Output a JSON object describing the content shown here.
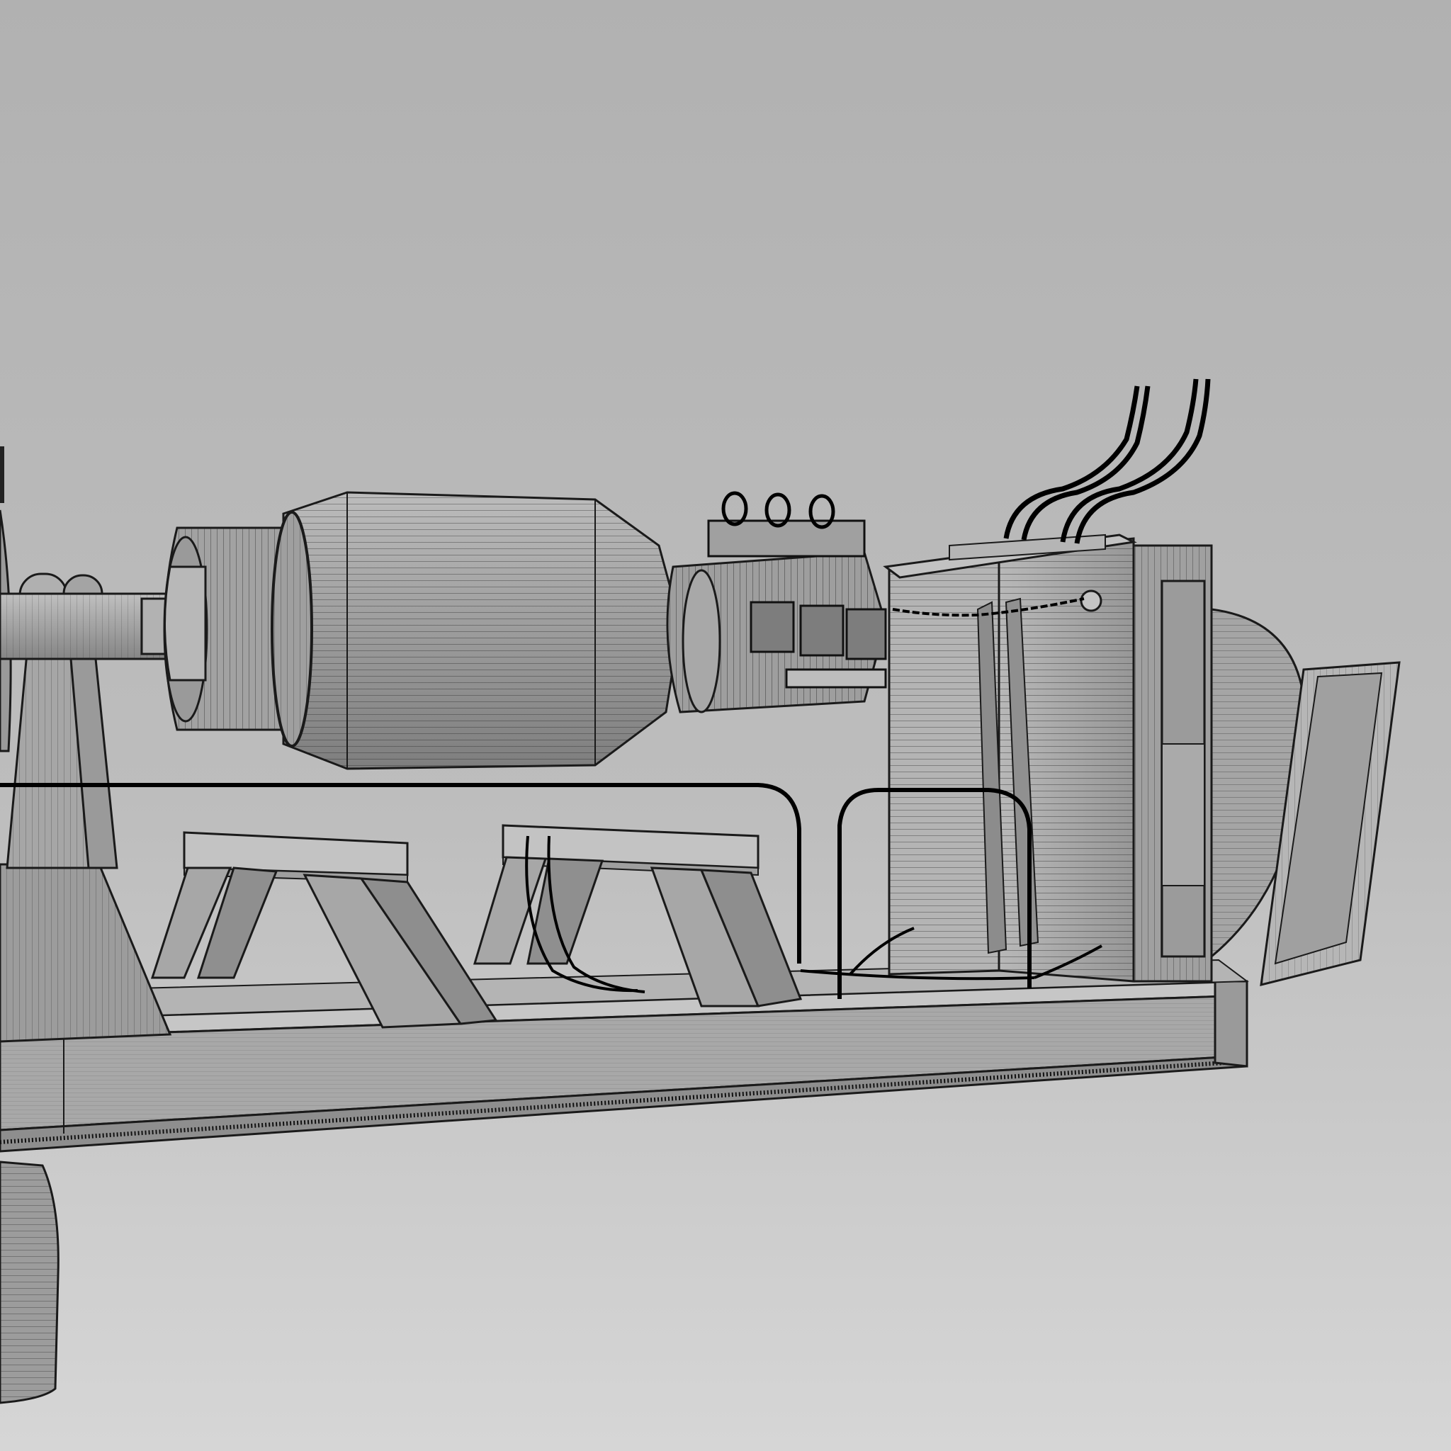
{
  "scene": {
    "render_style": "wireframe-shaded",
    "subject": "rotor-on-test-stand",
    "colors": {
      "background_top": "#b3b3b3",
      "background_bottom": "#d9d9d9",
      "surface": "#a9a9a9",
      "surface_light": "#c4c4c4",
      "surface_dark": "#8a8a8a",
      "edge": "#1a1a1a",
      "cable": "#000000"
    }
  }
}
